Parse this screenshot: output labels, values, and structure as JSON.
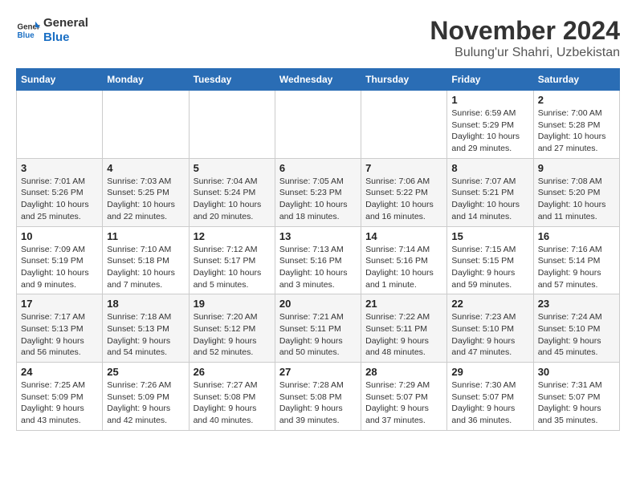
{
  "logo": {
    "general": "General",
    "blue": "Blue"
  },
  "title": "November 2024",
  "subtitle": "Bulung'ur Shahri, Uzbekistan",
  "days_header": [
    "Sunday",
    "Monday",
    "Tuesday",
    "Wednesday",
    "Thursday",
    "Friday",
    "Saturday"
  ],
  "weeks": [
    [
      {
        "day": "",
        "info": ""
      },
      {
        "day": "",
        "info": ""
      },
      {
        "day": "",
        "info": ""
      },
      {
        "day": "",
        "info": ""
      },
      {
        "day": "",
        "info": ""
      },
      {
        "day": "1",
        "info": "Sunrise: 6:59 AM\nSunset: 5:29 PM\nDaylight: 10 hours and 29 minutes."
      },
      {
        "day": "2",
        "info": "Sunrise: 7:00 AM\nSunset: 5:28 PM\nDaylight: 10 hours and 27 minutes."
      }
    ],
    [
      {
        "day": "3",
        "info": "Sunrise: 7:01 AM\nSunset: 5:26 PM\nDaylight: 10 hours and 25 minutes."
      },
      {
        "day": "4",
        "info": "Sunrise: 7:03 AM\nSunset: 5:25 PM\nDaylight: 10 hours and 22 minutes."
      },
      {
        "day": "5",
        "info": "Sunrise: 7:04 AM\nSunset: 5:24 PM\nDaylight: 10 hours and 20 minutes."
      },
      {
        "day": "6",
        "info": "Sunrise: 7:05 AM\nSunset: 5:23 PM\nDaylight: 10 hours and 18 minutes."
      },
      {
        "day": "7",
        "info": "Sunrise: 7:06 AM\nSunset: 5:22 PM\nDaylight: 10 hours and 16 minutes."
      },
      {
        "day": "8",
        "info": "Sunrise: 7:07 AM\nSunset: 5:21 PM\nDaylight: 10 hours and 14 minutes."
      },
      {
        "day": "9",
        "info": "Sunrise: 7:08 AM\nSunset: 5:20 PM\nDaylight: 10 hours and 11 minutes."
      }
    ],
    [
      {
        "day": "10",
        "info": "Sunrise: 7:09 AM\nSunset: 5:19 PM\nDaylight: 10 hours and 9 minutes."
      },
      {
        "day": "11",
        "info": "Sunrise: 7:10 AM\nSunset: 5:18 PM\nDaylight: 10 hours and 7 minutes."
      },
      {
        "day": "12",
        "info": "Sunrise: 7:12 AM\nSunset: 5:17 PM\nDaylight: 10 hours and 5 minutes."
      },
      {
        "day": "13",
        "info": "Sunrise: 7:13 AM\nSunset: 5:16 PM\nDaylight: 10 hours and 3 minutes."
      },
      {
        "day": "14",
        "info": "Sunrise: 7:14 AM\nSunset: 5:16 PM\nDaylight: 10 hours and 1 minute."
      },
      {
        "day": "15",
        "info": "Sunrise: 7:15 AM\nSunset: 5:15 PM\nDaylight: 9 hours and 59 minutes."
      },
      {
        "day": "16",
        "info": "Sunrise: 7:16 AM\nSunset: 5:14 PM\nDaylight: 9 hours and 57 minutes."
      }
    ],
    [
      {
        "day": "17",
        "info": "Sunrise: 7:17 AM\nSunset: 5:13 PM\nDaylight: 9 hours and 56 minutes."
      },
      {
        "day": "18",
        "info": "Sunrise: 7:18 AM\nSunset: 5:13 PM\nDaylight: 9 hours and 54 minutes."
      },
      {
        "day": "19",
        "info": "Sunrise: 7:20 AM\nSunset: 5:12 PM\nDaylight: 9 hours and 52 minutes."
      },
      {
        "day": "20",
        "info": "Sunrise: 7:21 AM\nSunset: 5:11 PM\nDaylight: 9 hours and 50 minutes."
      },
      {
        "day": "21",
        "info": "Sunrise: 7:22 AM\nSunset: 5:11 PM\nDaylight: 9 hours and 48 minutes."
      },
      {
        "day": "22",
        "info": "Sunrise: 7:23 AM\nSunset: 5:10 PM\nDaylight: 9 hours and 47 minutes."
      },
      {
        "day": "23",
        "info": "Sunrise: 7:24 AM\nSunset: 5:10 PM\nDaylight: 9 hours and 45 minutes."
      }
    ],
    [
      {
        "day": "24",
        "info": "Sunrise: 7:25 AM\nSunset: 5:09 PM\nDaylight: 9 hours and 43 minutes."
      },
      {
        "day": "25",
        "info": "Sunrise: 7:26 AM\nSunset: 5:09 PM\nDaylight: 9 hours and 42 minutes."
      },
      {
        "day": "26",
        "info": "Sunrise: 7:27 AM\nSunset: 5:08 PM\nDaylight: 9 hours and 40 minutes."
      },
      {
        "day": "27",
        "info": "Sunrise: 7:28 AM\nSunset: 5:08 PM\nDaylight: 9 hours and 39 minutes."
      },
      {
        "day": "28",
        "info": "Sunrise: 7:29 AM\nSunset: 5:07 PM\nDaylight: 9 hours and 37 minutes."
      },
      {
        "day": "29",
        "info": "Sunrise: 7:30 AM\nSunset: 5:07 PM\nDaylight: 9 hours and 36 minutes."
      },
      {
        "day": "30",
        "info": "Sunrise: 7:31 AM\nSunset: 5:07 PM\nDaylight: 9 hours and 35 minutes."
      }
    ]
  ]
}
